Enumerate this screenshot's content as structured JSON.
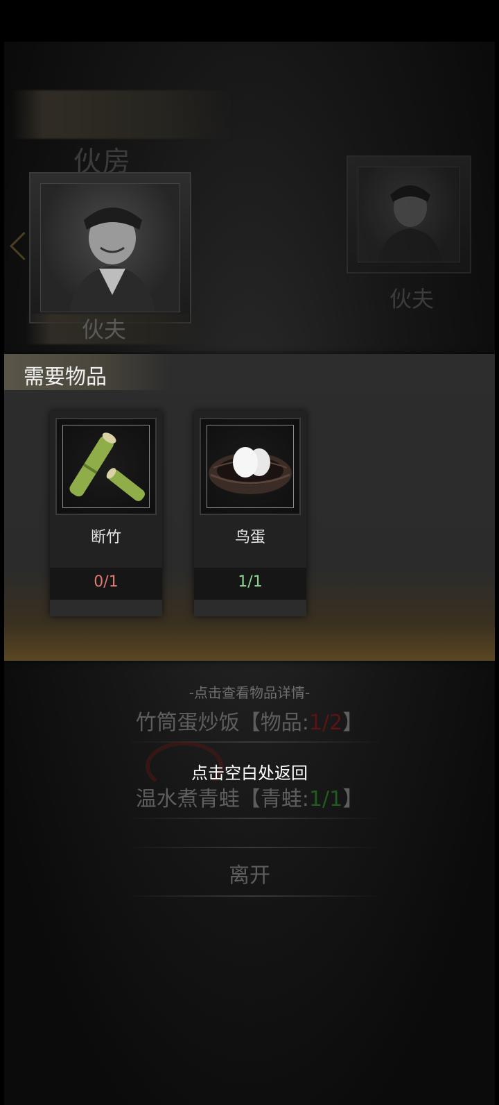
{
  "scene": {
    "title": "伙房",
    "npcs": [
      {
        "name": "伙夫"
      },
      {
        "name": "伙夫"
      }
    ]
  },
  "panel": {
    "title": "需要物品",
    "items": [
      {
        "name": "断竹",
        "count": "0/1",
        "count_color": "#e07a6e",
        "icon": "bamboo-icon"
      },
      {
        "name": "鸟蛋",
        "count": "1/1",
        "count_color": "#8fd694",
        "icon": "bird-egg-nest-icon"
      }
    ]
  },
  "menu": {
    "hint": "-点击查看物品详情-",
    "recipe1": {
      "name": "竹筒蛋炒饭",
      "open": "【物品:",
      "have": "1",
      "sep": "/",
      "need": "2",
      "close": "】"
    },
    "return_hint": "点击空白处返回",
    "recipe2": {
      "name": "温水煮青蛙",
      "open": "【青蛙:",
      "have": "1",
      "sep": "/",
      "need": "1",
      "close": "】"
    },
    "leave": "离开"
  }
}
